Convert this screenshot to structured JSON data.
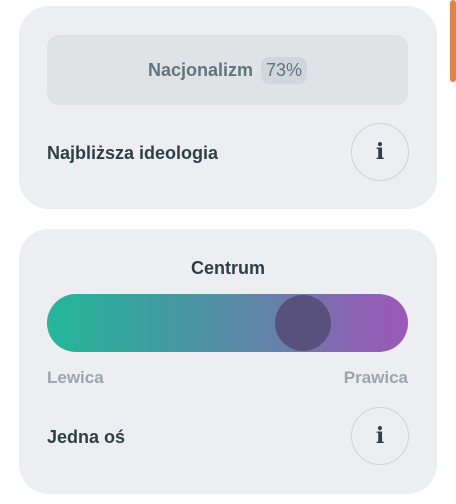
{
  "colors": {
    "card_bg": "#eceef1",
    "result_bg": "#dfe3e6",
    "gradient_left": "#22b89a",
    "gradient_right": "#9b59b6",
    "marker": "#58517d",
    "accent_scroll": "#e9803e"
  },
  "ideology_card": {
    "result_name": "Nacjonalizm",
    "result_percent": "73%",
    "label": "Najbliższa ideologia",
    "info_icon": "info-icon",
    "info_glyph": "i"
  },
  "axis_card": {
    "title": "Centrum",
    "left_label": "Lewica",
    "right_label": "Prawica",
    "marker_position": 0.71,
    "label": "Jedna oś",
    "info_icon": "info-icon",
    "info_glyph": "i"
  }
}
